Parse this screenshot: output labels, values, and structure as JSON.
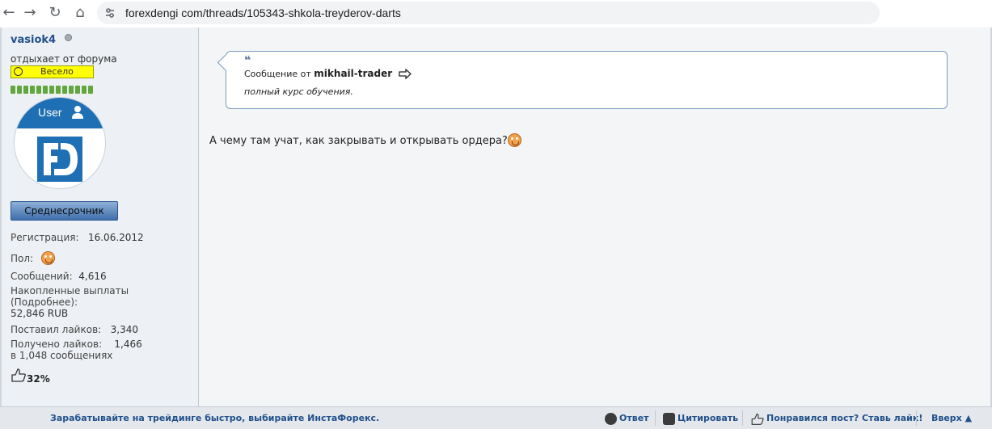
{
  "browser": {
    "url": "forexdengi com/threads/105343-shkola-treyderov-darts"
  },
  "user": {
    "name": "vasiok4",
    "status": "отдыхает от форума",
    "mood": "Весело",
    "avatar_label": "User",
    "rank": "Среднесрочник",
    "registration_label": "Регистрация:",
    "registration_value": "16.06.2012",
    "gender_label": "Пол:",
    "posts_label": "Сообщений:",
    "posts_value": "4,616",
    "payouts_label": "Накопленные выплаты",
    "payouts_link": "(Подробнее):",
    "payouts_value": "52,846 RUB",
    "likes_given_label": "Поставил лайков:",
    "likes_given_value": "3,340",
    "likes_received_label": "Получено лайков:",
    "likes_received_value": "1,466",
    "likes_received_in": "в 1,048 сообщениях",
    "like_percent": "32%"
  },
  "quote": {
    "prefix": "Сообщение от",
    "author": "mikhail-trader",
    "text": "полный курс обучения."
  },
  "message": {
    "text": "А чему там учат, как закрывать и открывать ордера?"
  },
  "footer": {
    "ad": "Зарабатывайте на трейдинге быстро, выбирайте ИнстаФорекс.",
    "reply": "Ответ",
    "quote": "Цитировать",
    "like": "Понравился пост? Ставь лайк!",
    "top": "Вверх ▲"
  },
  "colors": {
    "link": "#22508a",
    "rep_green": "#61a73e",
    "mood_yellow": "#ffff00",
    "avatar_blue": "#1f6fb5"
  }
}
